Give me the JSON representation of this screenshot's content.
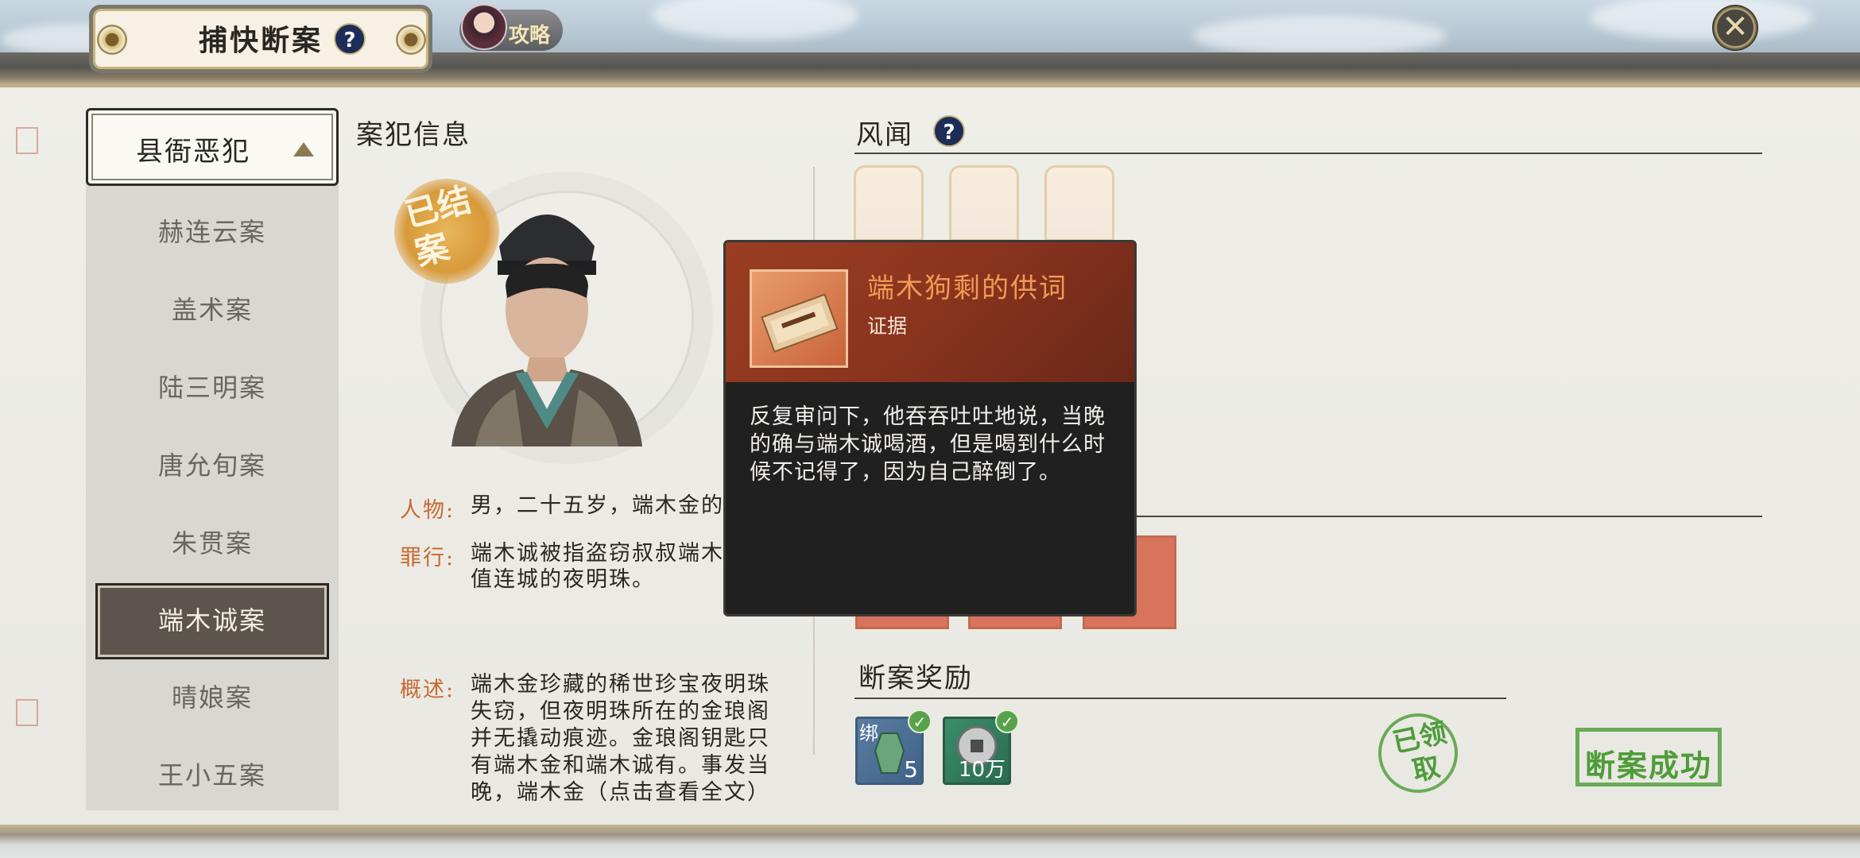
{
  "header": {
    "title": "捕快断案",
    "help": "?",
    "guide_label": "攻略",
    "close": "✕"
  },
  "sidebar": {
    "selected_category": "县衙恶犯",
    "items": [
      {
        "label": "赫连云案"
      },
      {
        "label": "盖术案"
      },
      {
        "label": "陆三明案"
      },
      {
        "label": "唐允旬案"
      },
      {
        "label": "朱贯案"
      },
      {
        "label": "端木诚案"
      },
      {
        "label": "晴娘案"
      },
      {
        "label": "王小五案"
      }
    ],
    "active_index": 5
  },
  "criminal": {
    "section_title": "案犯信息",
    "seal_text": "已结案",
    "person_label": "人物:",
    "person_value": "男，二十五岁，端木金的",
    "crime_label": "罪行:",
    "crime_value_1": "端木诚被指盗窃叔叔端木",
    "crime_value_2": "值连城的夜明珠。",
    "summary_label": "概述:",
    "summary_lines": [
      "端木金珍藏的稀世珍宝夜明珠",
      "失窃，但夜明珠所在的金琅阁",
      "并无撬动痕迹。金琅阁钥匙只",
      "有端木金和端木诚有。事发当",
      "晚，端木金（点击查看全文）"
    ]
  },
  "rumor": {
    "section_title": "风闻",
    "help": "?"
  },
  "evidence_hidden_label": "证据",
  "reward": {
    "section_title": "断案奖励",
    "items": [
      {
        "tag": "绑",
        "count": "5",
        "icon": "jade-token-icon"
      },
      {
        "tag": "",
        "count": "10万",
        "icon": "coin-icon"
      }
    ],
    "claimed_stamp": "已领取",
    "success_stamp": "断案成功"
  },
  "tooltip": {
    "title": "端木狗剩的供词",
    "type": "证据",
    "description": "反复审问下，他吞吞吐吐地说，当晚的确与端木诚喝酒，但是喝到什么时候不记得了，因为自己醉倒了。"
  },
  "colors": {
    "accent_orange": "#c8692f",
    "tooltip_title": "#f09a55",
    "stamp_green": "#4e9c3a",
    "help_blue": "#1d2d58"
  }
}
